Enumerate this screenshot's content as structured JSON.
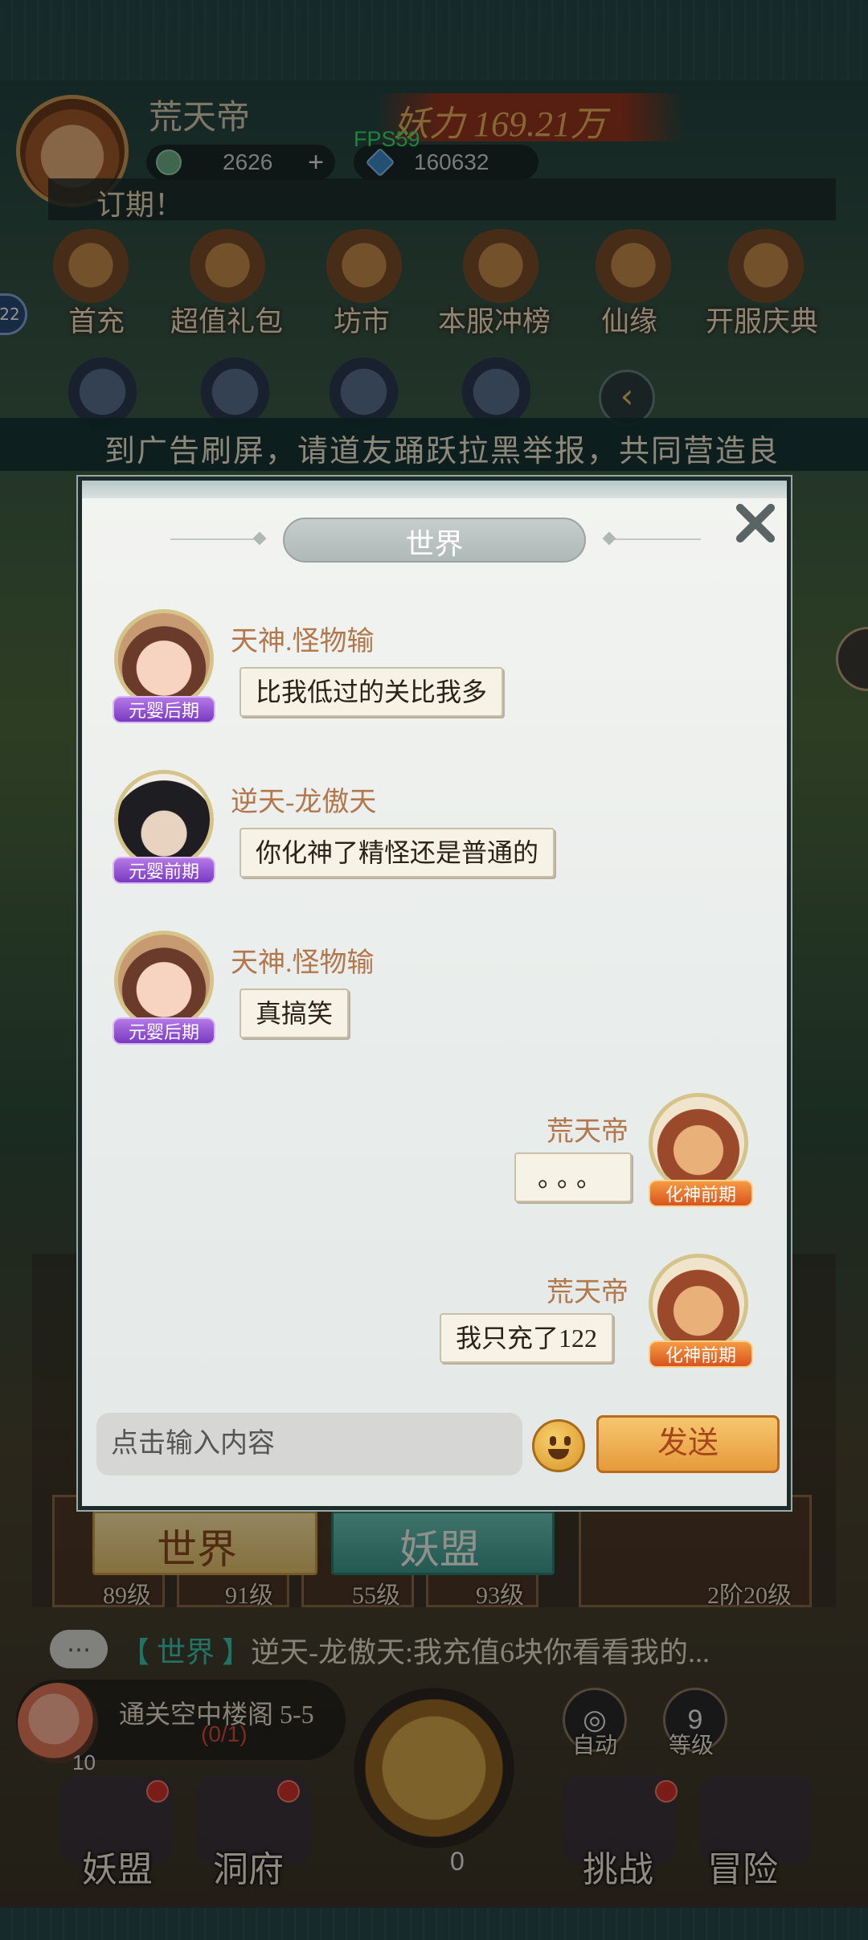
{
  "hud": {
    "player_name": "荒天帝",
    "power_text": "妖力 169.21万",
    "fps": "FPS59",
    "coins": "2626",
    "gems": "160632",
    "top_ticker": "订期！",
    "badge": "22"
  },
  "menu": {
    "items": [
      {
        "label": "首充"
      },
      {
        "label": "超值礼包"
      },
      {
        "label": "坊市"
      },
      {
        "label": "本服冲榜"
      },
      {
        "label": "仙缘"
      },
      {
        "label": "开服庆典"
      }
    ]
  },
  "announcement": "到广告刷屏，请道友踊跃拉黑举报，共同营造良",
  "chat_modal": {
    "title": "世界",
    "input_placeholder": "点击输入内容",
    "send_label": "发送",
    "messages": [
      {
        "sender": "天神.怪物输",
        "text": "比我低过的关比我多",
        "rank": "元婴后期",
        "side": "left",
        "avatar": "girl-avatar"
      },
      {
        "sender": "逆天-龙傲天",
        "text": "你化神了精怪还是普通的",
        "rank": "元婴前期",
        "side": "left",
        "avatar": "boy-avatar"
      },
      {
        "sender": "天神.怪物输",
        "text": "真搞笑",
        "rank": "元婴后期",
        "side": "left",
        "avatar": "girl-avatar"
      },
      {
        "sender": "荒天帝",
        "text": "。。。",
        "rank": "化神前期",
        "side": "right",
        "avatar": "monkey-avatar"
      },
      {
        "sender": "荒天帝",
        "text": "我只充了122",
        "rank": "化神前期",
        "side": "right",
        "avatar": "monkey-avatar"
      }
    ]
  },
  "chat_tabs": {
    "world": "世界",
    "alliance": "妖盟"
  },
  "background_levels": [
    "89级",
    "91级",
    "55级",
    "93级",
    "2阶20级"
  ],
  "chat_ticker": {
    "tag": "【 世界 】",
    "text": "逆天-龙傲天:我充值6块你看看我的..."
  },
  "quest": {
    "title": "通关空中楼阁 5-5",
    "progress": "(0/1)",
    "count": "10"
  },
  "side_buttons": {
    "auto_label": "自动",
    "level_label": "等级",
    "level_value": "9"
  },
  "bottom_nav": {
    "items": [
      {
        "label": "妖盟"
      },
      {
        "label": "洞府"
      },
      {
        "label": "挑战"
      },
      {
        "label": "冒险"
      }
    ],
    "center_count": "0"
  },
  "colors": {
    "sender_name": "#b2774a",
    "rank_purple": "#7a3ac0",
    "rank_orange": "#d8541e",
    "send_button": "#e59a3a",
    "fps_green": "#34e46a"
  }
}
